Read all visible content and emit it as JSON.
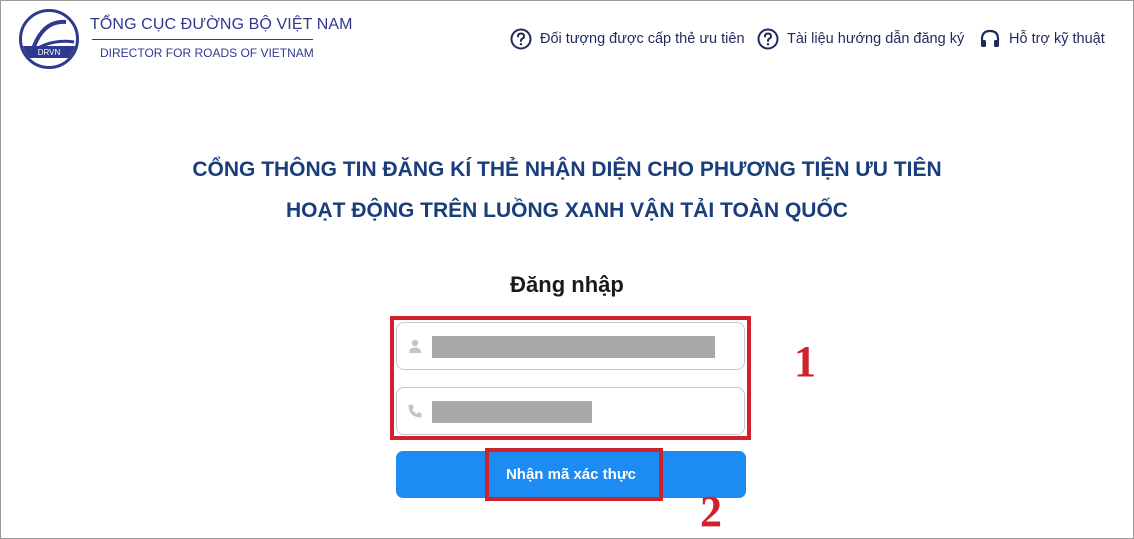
{
  "header": {
    "logo_text": "DRVN",
    "logo_ring_text": "ĐƯỜNG BỘ VIỆT NAM",
    "org_name": "TỔNG CỤC ĐƯỜNG BỘ VIỆT NAM",
    "org_subtitle": "DIRECTOR FOR ROADS OF VIETNAM",
    "nav": [
      {
        "label": "Đối tượng được cấp thẻ ưu tiên",
        "icon": "question-circle-icon"
      },
      {
        "label": "Tài liệu hướng dẫn đăng ký",
        "icon": "question-circle-icon"
      },
      {
        "label": "Hỗ trợ kỹ thuật",
        "icon": "headset-icon"
      }
    ]
  },
  "main": {
    "title_line1": "CỔNG THÔNG TIN ĐĂNG KÍ THẺ NHẬN DIỆN CHO PHƯƠNG TIỆN ƯU TIÊN",
    "title_line2": "HOẠT ĐỘNG TRÊN LUỒNG XANH VẬN TẢI TOÀN QUỐC",
    "login_heading": "Đăng nhập",
    "username_field": {
      "icon": "user-icon",
      "value": "",
      "placeholder": ""
    },
    "phone_field": {
      "icon": "phone-icon",
      "value": "",
      "placeholder": ""
    },
    "submit_label": "Nhận mã xác thực"
  },
  "annotations": {
    "label_1": "1",
    "label_2": "2",
    "color": "#d0222c"
  },
  "colors": {
    "brand": "#2f3a8f",
    "title": "#1a3d7c",
    "button": "#1d8cf2"
  }
}
